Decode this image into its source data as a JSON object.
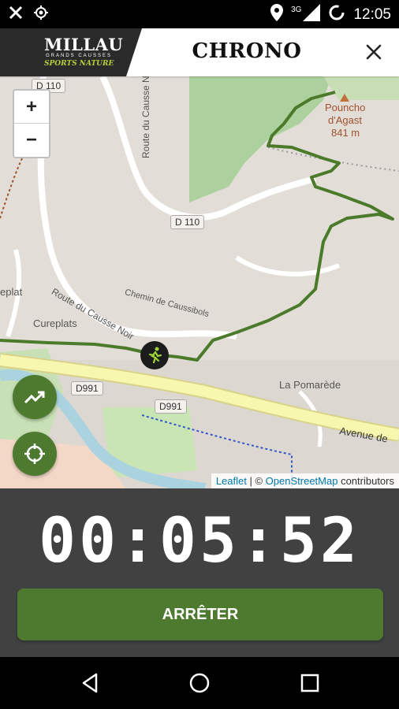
{
  "status_bar": {
    "time": "12:05",
    "network_label": "3G",
    "icons": [
      "crossed-tools-icon",
      "gps-target-icon",
      "location-pin-icon",
      "signal-icon",
      "sync-icon"
    ]
  },
  "header": {
    "logo": {
      "main": "MILLAU",
      "sub1": "GRANDS CAUSSES",
      "sub2": "SPORTS NATURE"
    },
    "title": "CHRONO",
    "close_icon": "close-icon"
  },
  "map": {
    "zoom_in": "+",
    "zoom_out": "−",
    "labels": {
      "d110_top": "D 110",
      "d110_mid": "D 110",
      "route_causse_noir_v": "Route du Causse Noir",
      "route_causse_noir_d": "Route du Causse Noir",
      "chemin": "Chemin de Caussibols",
      "cureplats": "Cureplats",
      "eplat": "eplat",
      "la_pomarede": "La Pomarède",
      "d991_left": "D991",
      "d991_mid": "D991",
      "avenue": "Avenue de",
      "poucho_name": "Pouncho",
      "poucho_name2": "d'Agast",
      "poucho_alt": "841 m"
    },
    "attribution": {
      "leaflet": "Leaflet",
      "sep": " | © ",
      "osm": "OpenStreetMap",
      "contrib": " contributors"
    },
    "colors": {
      "track": "#4a7a2a",
      "forest": "#add19e",
      "road_yellow": "#f7f7b0",
      "river": "#aad3df"
    }
  },
  "buttons": {
    "trend_icon": "trending-up-icon",
    "locate_icon": "crosshair-icon"
  },
  "timer": {
    "value": "00:05:52"
  },
  "stop_button": {
    "label": "ARRÊTER"
  },
  "nav": [
    "back-icon",
    "home-icon",
    "recents-icon"
  ],
  "colors": {
    "accent": "#4e7a30",
    "panel": "#414141"
  }
}
